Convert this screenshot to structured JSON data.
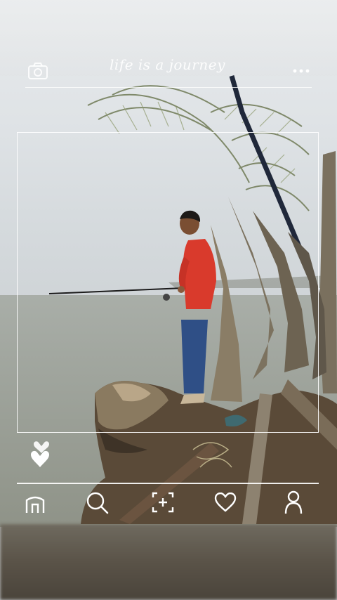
{
  "app": {
    "title": "life is a journey"
  },
  "header": {
    "icons": [
      "camera-icon",
      "more-icon"
    ]
  },
  "overlay": {
    "like_icon": "hearts-icon"
  },
  "bottom_nav": {
    "items": [
      {
        "name": "home",
        "icon": "home-icon"
      },
      {
        "name": "search",
        "icon": "search-icon"
      },
      {
        "name": "add",
        "icon": "add-post-icon"
      },
      {
        "name": "likes",
        "icon": "heart-icon"
      },
      {
        "name": "profile",
        "icon": "profile-icon"
      }
    ]
  },
  "colors": {
    "overlay_line": "#ffffff",
    "shirt": "#d93a2c",
    "jeans": "#2f4f86"
  }
}
